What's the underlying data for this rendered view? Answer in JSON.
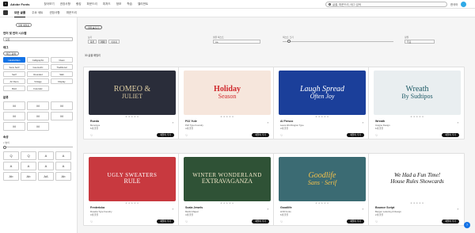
{
  "app": {
    "title": "Adobe Fonts",
    "logo_glyph": "f"
  },
  "topnav": [
    "찾아보기",
    "권장사항",
    "랭킹",
    "파운드리",
    "피처드",
    "정보",
    "학습",
    "엘리먼트"
  ],
  "search": {
    "placeholder": "글꼴, 파운드리, 태그 검색"
  },
  "language": "한국어",
  "tabs": [
    "모든 글꼴",
    "주요 세트",
    "권장사항",
    "파운드리"
  ],
  "sidebar": {
    "reset": "필터 재설정",
    "languages_title": "언어 및 언어 시스템",
    "language_value": "모든",
    "tags_title": "태그",
    "tag_button": "태그 검색",
    "tags": [
      "Handwritten",
      "Calligraphic",
      "Clean",
      "Sans Serif",
      "Geometric",
      "Traditional",
      "Serif",
      "Rounded",
      "Slab",
      "Art Deco",
      "Vintage",
      "Display",
      "Bold",
      "Futuristic"
    ],
    "classification_title": "분류",
    "classification": [
      "M",
      "M",
      "M",
      "M",
      "M",
      "M",
      "M",
      "M"
    ],
    "properties_title": "속성",
    "properties_sub": "x 높이",
    "property_cells": [
      "Q",
      "Q",
      "A",
      "A",
      "A",
      "A",
      "A",
      "A",
      "Ab",
      "Ab",
      "AA",
      "Ab"
    ]
  },
  "toolbar": {
    "view_label": "보기",
    "view_options": [
      "목록",
      "격자",
      "이미지"
    ],
    "sample_label": "샘플 텍스트",
    "sample_value": "Aa",
    "size_label": "텍스트 크기",
    "sort_label": "정렬",
    "sort_value": "주요"
  },
  "filter_chip": "필터 숨기기",
  "results": "30 글꼴 패밀리",
  "cards": [
    {
      "name": "Rueda",
      "foundry": "Monotype",
      "count": "5개 글꼴",
      "art": [
        "ROMEO &",
        "JULIET"
      ],
      "bg": "#2a2d3a",
      "fg": "#d9c9a0"
    },
    {
      "name": "P22 Yule",
      "foundry": "P22 Type Foundry",
      "count": "4개 글꼴",
      "art": [
        "Holiday",
        "Season"
      ],
      "bg": "#f6e6dc",
      "fg": "#d0282c"
    },
    {
      "name": "Al Fresco",
      "foundry": "Laura Worthington Type",
      "count": "3개 글꼴",
      "art": [
        "Laugh Spread",
        "Often Joy"
      ],
      "bg": "#1b3f9a",
      "fg": "#ffffff"
    },
    {
      "name": "Wreath",
      "foundry": "Insigne Design",
      "count": "6개 글꼴",
      "art": [
        "Wreath",
        "By Sudtipos"
      ],
      "bg": "#e9eef0",
      "fg": "#1e5a66"
    },
    {
      "name": "Fredericka",
      "foundry": "Rosetta Type Foundry",
      "count": "3개 글꼴",
      "art": [
        "UGLY SWEATERS",
        "RULE"
      ],
      "bg": "#c8393f",
      "fg": "#ffffff"
    },
    {
      "name": "Scala Jewels",
      "foundry": "Martin Majoor",
      "count": "4개 글꼴",
      "art": [
        "WINTER WONDERLAND",
        "EXTRAVAGANZA"
      ],
      "bg": "#2f5236",
      "fg": "#f0e6c8"
    },
    {
      "name": "Goodlife",
      "foundry": "HVD Fonts",
      "count": "6개 글꼴",
      "art": [
        "Goodlife",
        "Sans · Serif"
      ],
      "bg": "#3b6b73",
      "fg": "#f3c04b"
    },
    {
      "name": "Bounce Script",
      "foundry": "Bergen Lettering & Design",
      "count": "2개 글꼴",
      "art": [
        "We Had a Fun Time!",
        "House Rules Showcards"
      ],
      "bg": "#ffffff",
      "fg": "#111111"
    }
  ],
  "card_action": "패밀리 추가",
  "help": "?"
}
